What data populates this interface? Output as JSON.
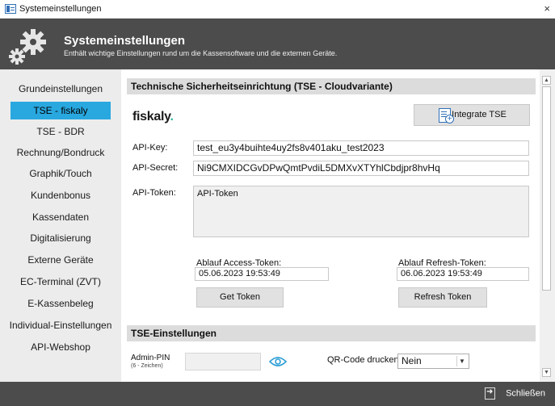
{
  "window": {
    "title": "Systemeinstellungen",
    "close_glyph": "×"
  },
  "header": {
    "title": "Systemeinstellungen",
    "subtitle": "Enthält wichtige Einstellungen rund um die Kassensoftware und die externen Geräte.",
    "icon": "gears-icon"
  },
  "sidebar": {
    "active_index": 1,
    "accent_color": "#29a8e0",
    "items": [
      {
        "label": "Grundeinstellungen"
      },
      {
        "label": "TSE - fiskaly"
      },
      {
        "label": "TSE - BDR"
      },
      {
        "label": "Rechnung/Bondruck"
      },
      {
        "label": "Graphik/Touch"
      },
      {
        "label": "Kundenbonus"
      },
      {
        "label": "Kassendaten"
      },
      {
        "label": "Digitalisierung"
      },
      {
        "label": "Externe Geräte"
      },
      {
        "label": "EC-Terminal (ZVT)"
      },
      {
        "label": "E-Kassenbeleg"
      },
      {
        "label": "Individual-Einstellungen"
      },
      {
        "label": "API-Webshop"
      }
    ]
  },
  "tse": {
    "section_title": "Technische Sicherheitseinrichtung (TSE - Cloudvariante)",
    "logo": {
      "text": "fiskaly",
      "dot": ".",
      "dot_color": "#2bb8a0"
    },
    "integrate_button": "Integrate TSE",
    "api_key_label": "API-Key:",
    "api_key_value": "test_eu3y4buihte4uy2fs8v401aku_test2023",
    "api_secret_label": "API-Secret:",
    "api_secret_value": "Ni9CMXIDCGvDPwQmtPvdiL5DMXvXTYhlCbdjpr8hvHq",
    "api_token_label": "API-Token:",
    "api_token_value": "API-Token",
    "access_expiry_label": "Ablauf Access-Token:",
    "access_expiry_value": "05.06.2023 19:53:49",
    "refresh_expiry_label": "Ablauf Refresh-Token:",
    "refresh_expiry_value": "06.06.2023 19:53:49",
    "get_token_button": "Get Token",
    "refresh_token_button": "Refresh Token"
  },
  "settings": {
    "section_title": "TSE-Einstellungen",
    "admin_pin_label": "Admin-PIN",
    "admin_pin_hint": "(6 - Zeichen)",
    "admin_pin_value": "",
    "qr_label": "QR-Code drucken:",
    "qr_value": "Nein"
  },
  "footer": {
    "close_label": "Schließen"
  }
}
